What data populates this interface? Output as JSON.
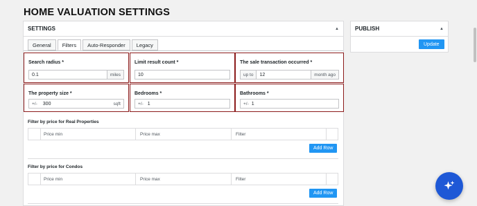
{
  "page": {
    "title": "HOME VALUATION SETTINGS"
  },
  "settings_panel": {
    "title": "SETTINGS",
    "tabs": [
      {
        "label": "General"
      },
      {
        "label": "Filters"
      },
      {
        "label": "Auto-Responder"
      },
      {
        "label": "Legacy"
      }
    ],
    "active_tab": "Filters",
    "fields": {
      "search_radius": {
        "label": "Search radius *",
        "value": "0.1",
        "suffix": "miles"
      },
      "limit_result_count": {
        "label": "Limit result count *",
        "value": "10"
      },
      "sale_transaction": {
        "label": "The sale transaction occurred *",
        "prefix": "up to",
        "value": "12",
        "suffix": "month ago"
      },
      "property_size": {
        "label": "The property size *",
        "prefix": "+/-",
        "value": "300",
        "suffix": "sqft"
      },
      "bedrooms": {
        "label": "Bedrooms *",
        "prefix": "+/-",
        "value": "1"
      },
      "bathrooms": {
        "label": "Bathrooms *",
        "prefix": "+/-",
        "value": "1"
      }
    },
    "real_properties": {
      "title": "Filter by price for Real Properties",
      "columns": [
        "Price min",
        "Price max",
        "Filter"
      ],
      "add_row_label": "Add Row"
    },
    "condos": {
      "title": "Filter by price for Condos",
      "columns": [
        "Price min",
        "Price max",
        "Filter"
      ],
      "add_row_label": "Add Row"
    }
  },
  "publish_panel": {
    "title": "PUBLISH",
    "update_label": "Update"
  },
  "colors": {
    "accent": "#2196f3",
    "highlight_border": "#8b1a1a",
    "fab": "#1e58d6"
  },
  "icons": {
    "collapse": "caret-up-icon",
    "fab": "sparkle-icon"
  }
}
